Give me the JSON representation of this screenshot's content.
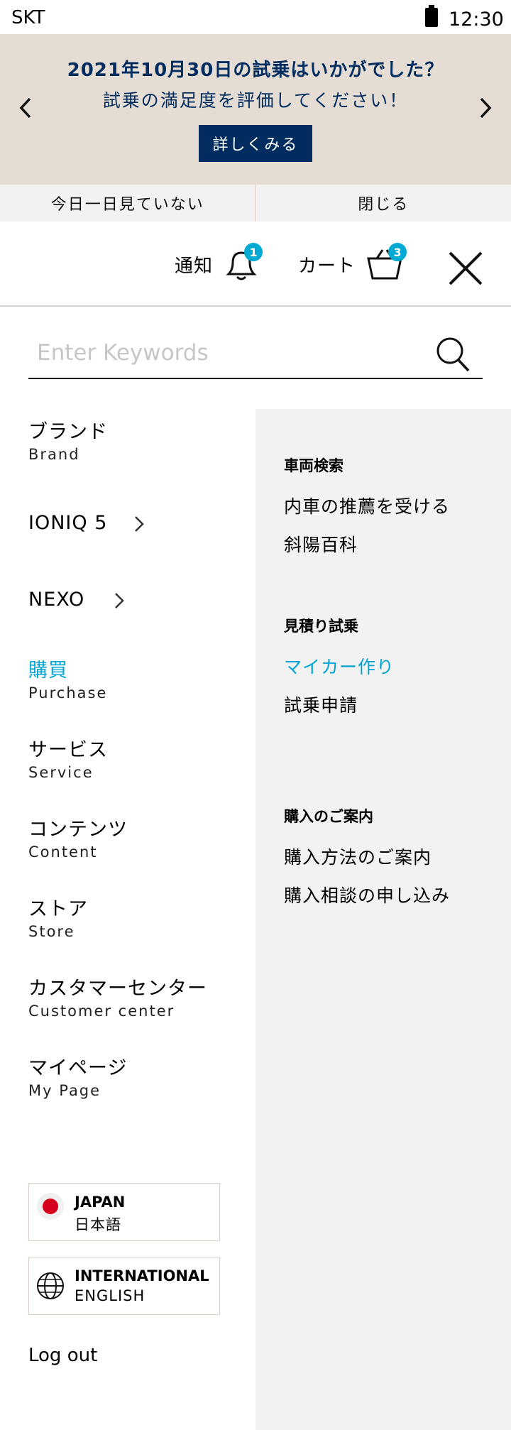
{
  "status_bar": {
    "carrier": "SKT",
    "time": "12:30"
  },
  "promo": {
    "title": "2021年10月30日の試乗はいかがでした？",
    "subtitle": "試乗の満足度を評価してください！",
    "button_label": "詳しくみる"
  },
  "banner_actions": {
    "hide_today": "今日一日見ていない",
    "close": "閉じる"
  },
  "header": {
    "notification_label": "通知",
    "notification_count": "1",
    "cart_label": "カート",
    "cart_count": "3"
  },
  "search": {
    "placeholder": "Enter Keywords",
    "value": ""
  },
  "nav": {
    "brand": {
      "main": "ブランド",
      "sub": "Brand"
    },
    "ioniq5": {
      "main": "IONIQ 5"
    },
    "nexo": {
      "main": "NEXO"
    },
    "purchase": {
      "main": "購買",
      "sub": "Purchase"
    },
    "service": {
      "main": "サービス",
      "sub": "Service"
    },
    "content": {
      "main": "コンテンツ",
      "sub": "Content"
    },
    "store": {
      "main": "ストア",
      "sub": "Store"
    },
    "customer_center": {
      "main": "カスタマーセンター",
      "sub": "Customer center"
    },
    "mypage": {
      "main": "マイページ",
      "sub": "My Page"
    }
  },
  "submenu": {
    "vehicle_search": {
      "title": "車両検索",
      "links": [
        "内車の推薦を受ける",
        "斜陽百科"
      ]
    },
    "estimate": {
      "title": "見積り試乗",
      "links": [
        "マイカー作り",
        "試乗申請"
      ]
    },
    "purchase_guide": {
      "title": "購入のご案内",
      "links": [
        "購入方法のご案内",
        "購入相談の申し込み"
      ]
    }
  },
  "languages": {
    "japan": {
      "region": "JAPAN",
      "language": "日本語"
    },
    "international": {
      "region": "INTERNATIONAL",
      "language": "ENGLISH"
    }
  },
  "logout": "Log out",
  "colors": {
    "navy": "#002c5f",
    "accent": "#00a5d6",
    "badge": "#00aad2",
    "banner_bg": "#e5ddd3",
    "panel_bg": "#f2f2f2"
  }
}
